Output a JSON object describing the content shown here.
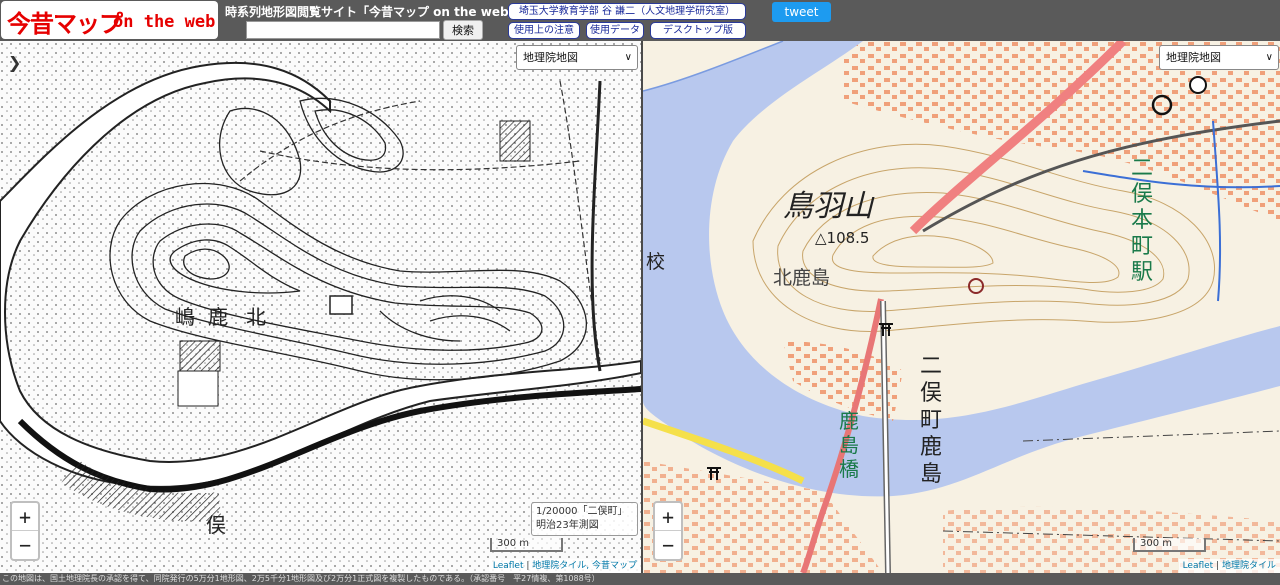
{
  "header": {
    "logo_main": "今昔マップ",
    "logo_sub": "on the web",
    "site_title": "時系列地形図閲覧サイト「今昔マップ on the web」",
    "search_value": "",
    "search_button": "検索",
    "author_button": "埼玉大学教育学部 谷 謙二（人文地理学研究室）",
    "notes_button": "使用上の注意",
    "data_button": "使用データ",
    "desktop_button": "デスクトップ版",
    "tweet_button": "tweet"
  },
  "old_map": {
    "layer_select": "地理院地図",
    "zoom_in": "+",
    "zoom_out": "−",
    "scale": "300 m",
    "sheet_info_line1": "1/20000「二俣町」",
    "sheet_info_line2": "明治23年測図",
    "attribution_prefix": "Leaflet",
    "attribution_links": "地理院タイル, 今昔マップ",
    "labels": {
      "kita": "北",
      "ka": "鹿",
      "shima": "嶋",
      "mata": "俣"
    }
  },
  "new_map": {
    "layer_select": "地理院地図",
    "zoom_in": "+",
    "zoom_out": "−",
    "scale": "300 m",
    "attribution_prefix": "Leaflet",
    "attribution_links": "地理院タイル",
    "labels": {
      "mountain": "鳥羽山",
      "elevation": "△108.5",
      "kitakashima": "北鹿島",
      "station": "二俣本町駅",
      "futamata_kashima": "二俣町鹿島",
      "bridge": "鹿島橋",
      "school": "校"
    }
  },
  "footer": {
    "text": "この地図は、国土地理院長の承認を得て、同院発行の5万分1地形図、2万5千分1地形図及び2万分1正式図を複製したものである。（承認番号　平27情複、第1088号）"
  }
}
